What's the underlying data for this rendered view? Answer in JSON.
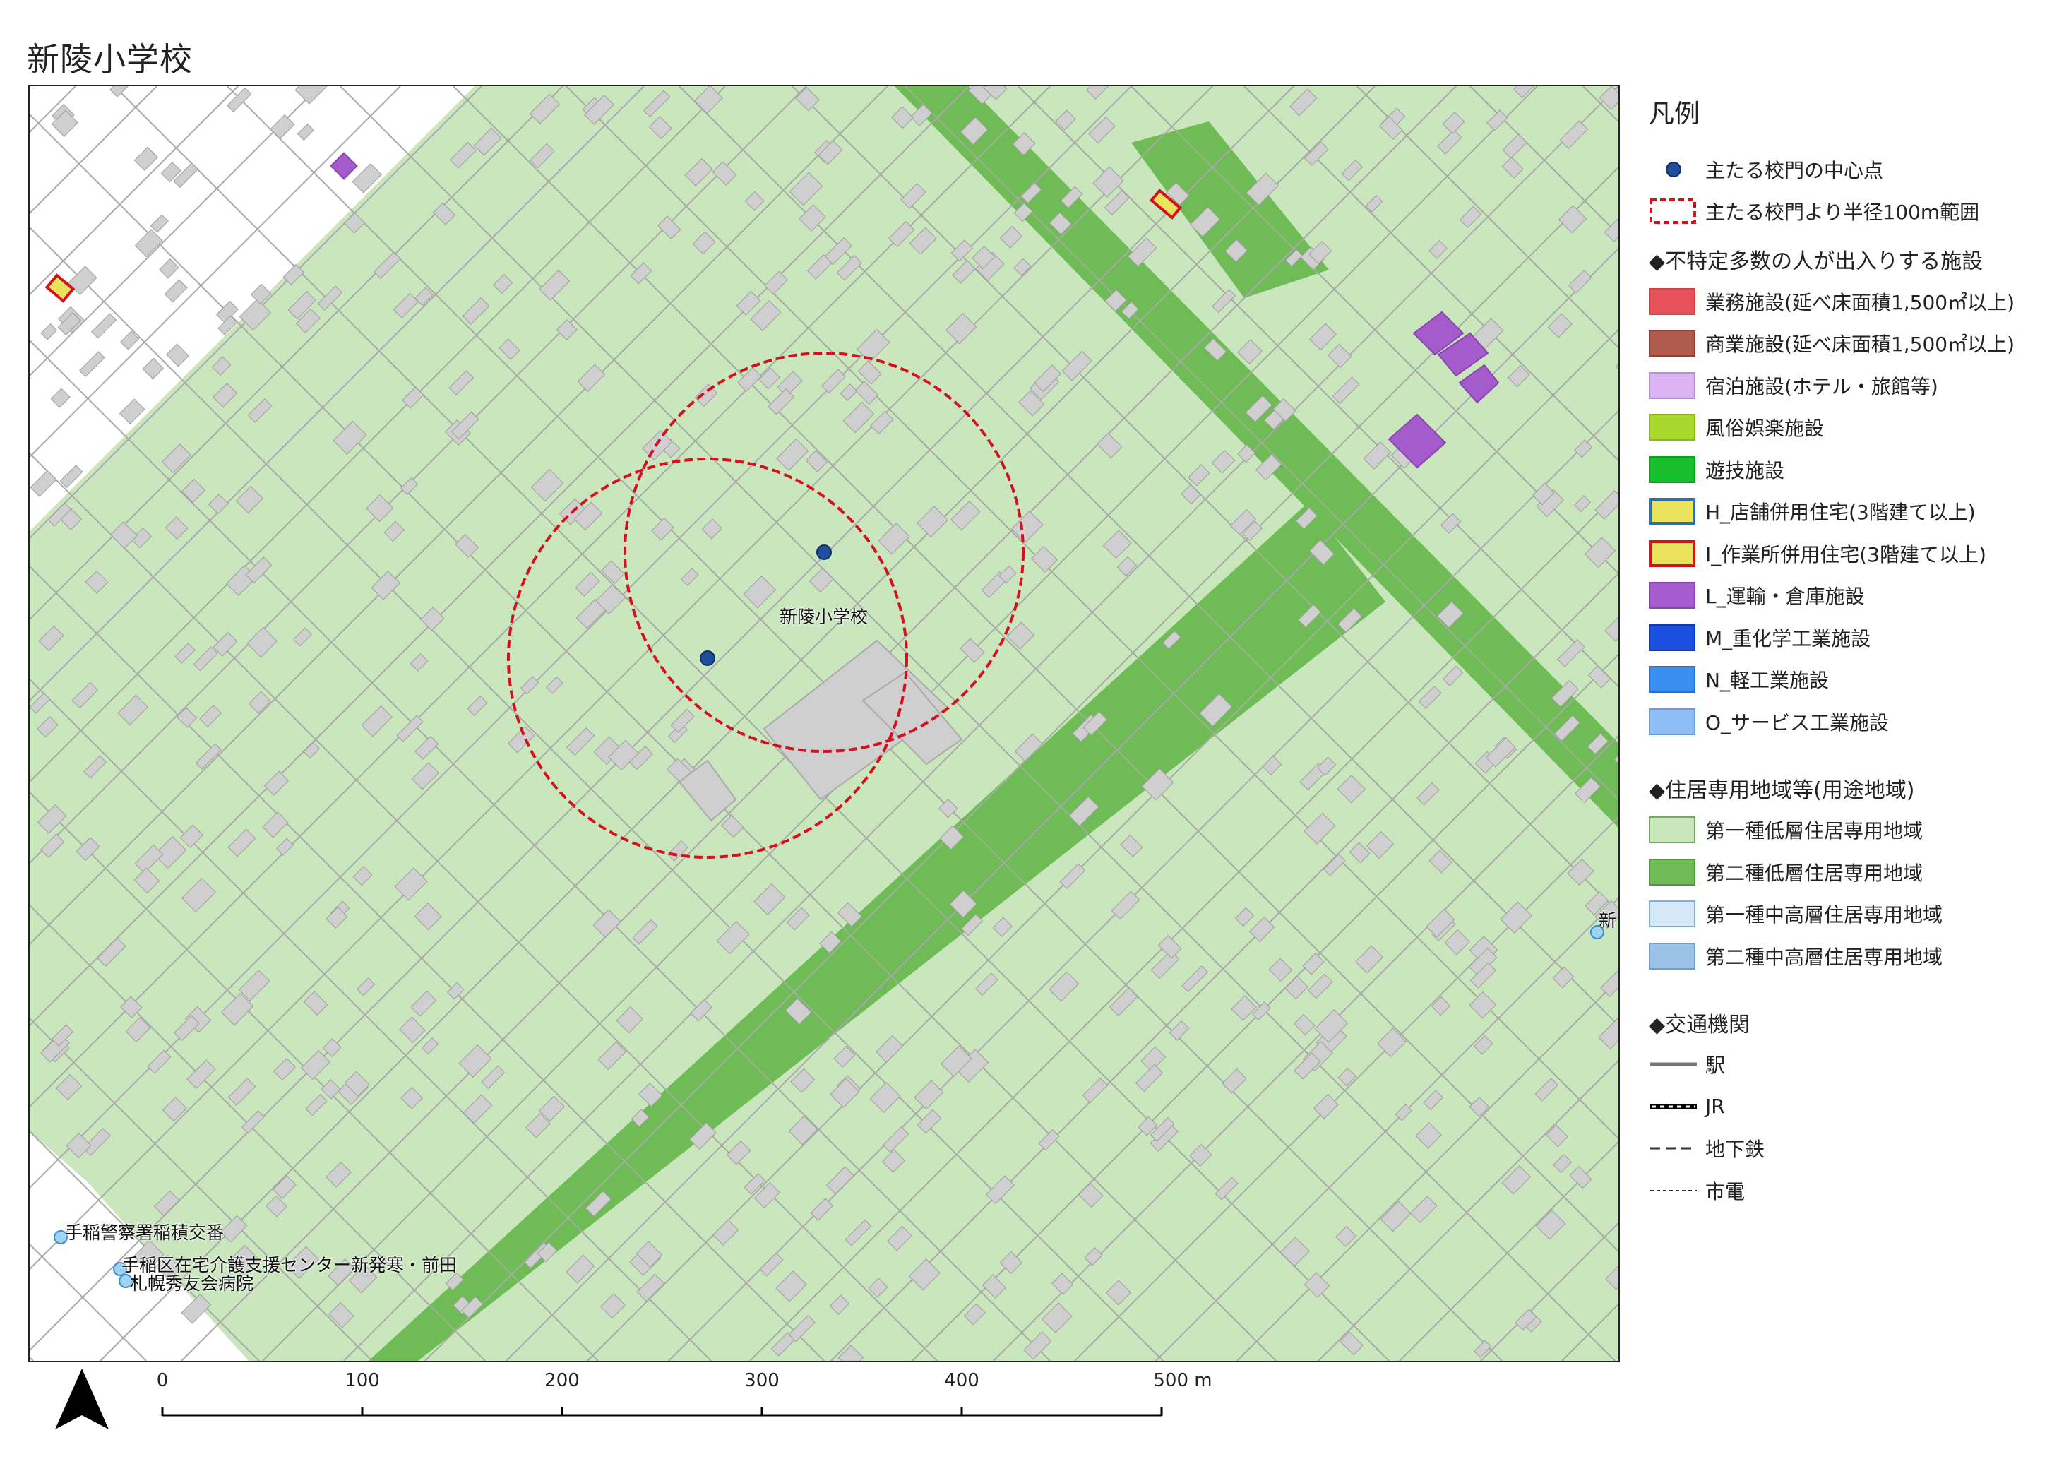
{
  "page": {
    "title": "新陵小学校"
  },
  "map": {
    "school_label": "新陵小学校",
    "edge_label": "新",
    "pois": [
      {
        "label": "手稲警察署稲積交番"
      },
      {
        "label": "手稲区在宅介護支援センター新発寒・前田"
      },
      {
        "label": "札幌秀友会病院"
      }
    ],
    "colors": {
      "zone1_low": "#c9e6bd",
      "zone2_low": "#6fbb55",
      "building": "#cfcfcf",
      "outside_zone": "#ffffff",
      "gate_point": "#1f4e9c",
      "radius_line": "#d4121f"
    }
  },
  "legend": {
    "title": "凡例",
    "items_top": [
      {
        "id": "gate",
        "label": "主たる校門の中心点",
        "symbol": "dot",
        "color": "#1f4e9c"
      },
      {
        "id": "radius",
        "label": "主たる校門より半径100m範囲",
        "symbol": "dashed-box",
        "color": "#d4121f"
      }
    ],
    "facilities_heading": "◆不特定多数の人が出入りする施設",
    "facilities": [
      {
        "label": "業務施設(延べ床面積1,500㎡以上)",
        "fill": "#e8525a",
        "border": "#c44"
      },
      {
        "label": "商業施設(延べ床面積1,500㎡以上)",
        "fill": "#b05a4e",
        "border": "#8a3f35"
      },
      {
        "label": "宿泊施設(ホテル・旅館等)",
        "fill": "#d9b3f2",
        "border": "#b48fd6"
      },
      {
        "label": "風俗娯楽施設",
        "fill": "#a8d82e",
        "border": "#8ab820"
      },
      {
        "label": "遊技施設",
        "fill": "#17bf2c",
        "border": "#0f9a20"
      },
      {
        "label": "H_店舗併用住宅(3階建て以上)",
        "fill": "#e8e35a",
        "border": "#2a6fb5"
      },
      {
        "label": "I_作業所併用住宅(3階建て以上)",
        "fill": "#e8e35a",
        "border": "#d4121f"
      },
      {
        "label": "L_運輸・倉庫施設",
        "fill": "#a45ccc",
        "border": "#8a45b0"
      },
      {
        "label": "M_重化学工業施設",
        "fill": "#1a4fe0",
        "border": "#1238b0"
      },
      {
        "label": "N_軽工業施設",
        "fill": "#3a8ef0",
        "border": "#2a70c8"
      },
      {
        "label": "O_サービス工業施設",
        "fill": "#8fbdf4",
        "border": "#6a9ed8"
      }
    ],
    "zones_heading": "◆住居専用地域等(用途地域)",
    "zones": [
      {
        "label": "第一種低層住居専用地域",
        "fill": "#c9e6bd",
        "border": "#6fa85e"
      },
      {
        "label": "第二種低層住居専用地域",
        "fill": "#6fbb55",
        "border": "#4f9a3c"
      },
      {
        "label": "第一種中高層住居専用地域",
        "fill": "#d6e8f8",
        "border": "#7aaedc"
      },
      {
        "label": "第二種中高層住居専用地域",
        "fill": "#9cc2e6",
        "border": "#6a9ed0"
      }
    ],
    "transport_heading": "◆交通機関",
    "transport": [
      {
        "label": "駅",
        "style": "solid"
      },
      {
        "label": "JR",
        "style": "rail"
      },
      {
        "label": "地下鉄",
        "style": "long-dash"
      },
      {
        "label": "市電",
        "style": "short-dash"
      }
    ]
  },
  "scale": {
    "labels": [
      "0",
      "100",
      "200",
      "300",
      "400",
      "500 m"
    ],
    "values_m": [
      0,
      100,
      200,
      300,
      400,
      500
    ]
  }
}
